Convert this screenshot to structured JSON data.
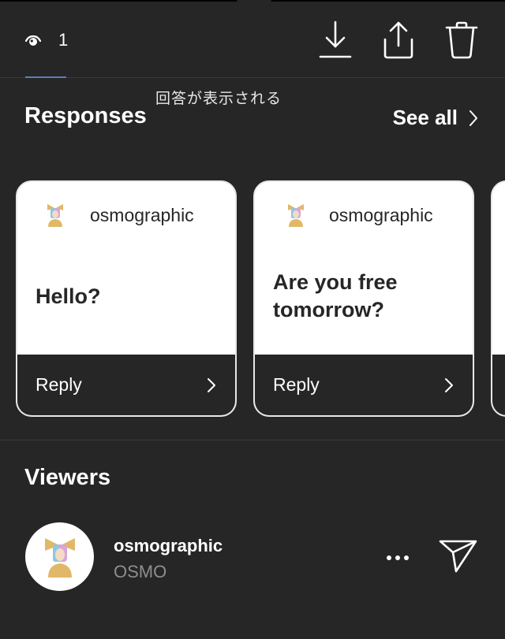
{
  "header": {
    "view_count": "1",
    "icons": {
      "views": "eye-icon",
      "download": "download-icon",
      "share": "share-icon",
      "delete": "trash-icon"
    },
    "active_tab_color": "#5b7fbf"
  },
  "caption_overlay": "回答が表示される",
  "responses": {
    "title": "Responses",
    "see_all_label": "See all",
    "cards": [
      {
        "username": "osmographic",
        "message": "Hello?",
        "reply_label": "Reply"
      },
      {
        "username": "osmographic",
        "message": "Are you free tomorrow?",
        "reply_label": "Reply"
      }
    ]
  },
  "viewers": {
    "title": "Viewers",
    "items": [
      {
        "username": "osmographic",
        "full_name": "OSMO"
      }
    ]
  },
  "colors": {
    "background": "#262626",
    "card_background": "#ffffff",
    "secondary_text": "#8e8e8e"
  }
}
